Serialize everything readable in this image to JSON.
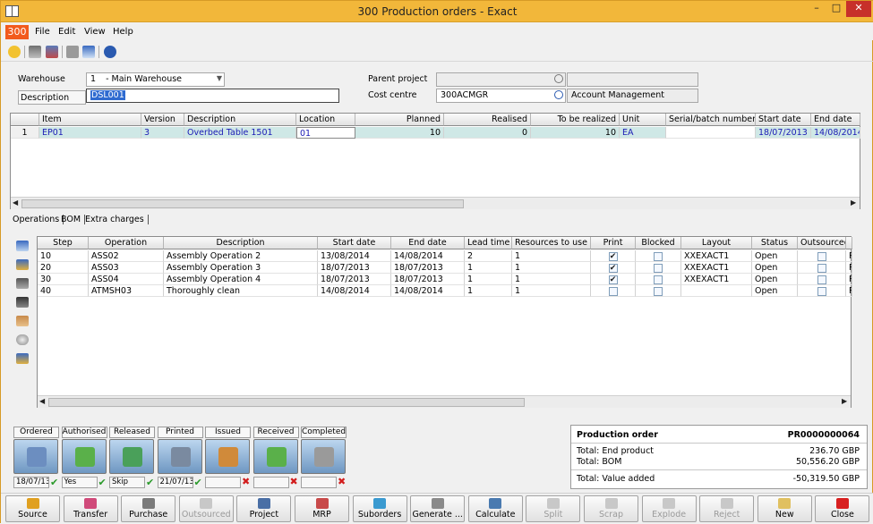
{
  "window": {
    "title": "300 Production orders - Exact",
    "min": "–",
    "max": "□",
    "close": "✕"
  },
  "menu": {
    "company": "300",
    "items": [
      "File",
      "Edit",
      "View",
      "Help"
    ]
  },
  "header": {
    "warehouse_label": "Warehouse",
    "warehouse_code": "1",
    "warehouse_name": "- Main Warehouse",
    "description_label": "Description",
    "description_value": "DSL001",
    "parent_project_label": "Parent project",
    "parent_project_value": "",
    "parent_project_desc": "",
    "cost_centre_label": "Cost centre",
    "cost_centre_value": "300ACMGR",
    "cost_centre_desc": "Account Management"
  },
  "items_grid": {
    "headers": [
      "Item",
      "Version",
      "Description",
      "Location",
      "Planned",
      "Realised",
      "To be realized",
      "Unit",
      "Serial/batch numbers",
      "Start date",
      "End date"
    ],
    "rows": [
      [
        "1",
        "EP01",
        "3",
        "Overbed Table 1501",
        "01",
        "10",
        "0",
        "10",
        "EA",
        "",
        "18/07/2013",
        "14/08/2014"
      ]
    ]
  },
  "tabs": [
    "Operations",
    "BOM",
    "Extra charges"
  ],
  "ops_grid": {
    "headers": [
      "Step",
      "Operation",
      "Description",
      "Start date",
      "End date",
      "Lead time",
      "Resources to use",
      "Print",
      "Blocked",
      "Layout",
      "Status",
      "Outsourced"
    ],
    "rows": [
      {
        "step": "10",
        "op": "ASS02",
        "desc": "Assembly Operation 2",
        "start": "13/08/2014",
        "end": "14/08/2014",
        "lead": "2",
        "res": "1",
        "print": true,
        "blocked": false,
        "layout": "XXEXACT1",
        "status": "Open",
        "outs": false,
        "extra": "P"
      },
      {
        "step": "20",
        "op": "ASS03",
        "desc": "Assembly Operation 3",
        "start": "18/07/2013",
        "end": "18/07/2013",
        "lead": "1",
        "res": "1",
        "print": true,
        "blocked": false,
        "layout": "XXEXACT1",
        "status": "Open",
        "outs": false,
        "extra": "P"
      },
      {
        "step": "30",
        "op": "ASS04",
        "desc": "Assembly Operation 4",
        "start": "18/07/2013",
        "end": "18/07/2013",
        "lead": "1",
        "res": "1",
        "print": true,
        "blocked": false,
        "layout": "XXEXACT1",
        "status": "Open",
        "outs": false,
        "extra": "P"
      },
      {
        "step": "40",
        "op": "ATMSH03",
        "desc": "Thoroughly clean",
        "start": "14/08/2014",
        "end": "14/08/2014",
        "lead": "1",
        "res": "1",
        "print": false,
        "blocked": false,
        "layout": "",
        "status": "Open",
        "outs": false,
        "extra": "P"
      }
    ]
  },
  "status_steps": [
    {
      "label": "Ordered",
      "value": "18/07/13",
      "mark": "ok"
    },
    {
      "label": "Authorised",
      "value": "Yes",
      "mark": "ok"
    },
    {
      "label": "Released",
      "value": "Skip",
      "mark": "ok"
    },
    {
      "label": "Printed",
      "value": "21/07/13",
      "mark": "ok"
    },
    {
      "label": "Issued",
      "value": "",
      "mark": "x"
    },
    {
      "label": "Received",
      "value": "",
      "mark": "x"
    },
    {
      "label": "Completed",
      "value": "",
      "mark": "x"
    }
  ],
  "summary": {
    "title": "Production order",
    "order_no": "PR0000000064",
    "end_product_label": "Total: End product",
    "end_product_value": "236.70 GBP",
    "bom_label": "Total: BOM",
    "bom_value": "50,556.20 GBP",
    "value_added_label": "Total: Value added",
    "value_added_value": "-50,319.50 GBP"
  },
  "actions": [
    {
      "label": "Source",
      "enabled": true,
      "icon": "source-icon",
      "color": "#e0a020"
    },
    {
      "label": "Transfer",
      "enabled": true,
      "icon": "transfer-icon",
      "color": "#d04a7a"
    },
    {
      "label": "Purchase",
      "enabled": true,
      "icon": "purchase-icon",
      "color": "#7a7a7a"
    },
    {
      "label": "Outsourced",
      "enabled": false,
      "icon": "outsourced-icon",
      "color": "#888"
    },
    {
      "label": "Project",
      "enabled": true,
      "icon": "project-icon",
      "color": "#4a6fa5"
    },
    {
      "label": "MRP",
      "enabled": true,
      "icon": "mrp-icon",
      "color": "#c84a4a"
    },
    {
      "label": "Suborders",
      "enabled": true,
      "icon": "suborders-icon",
      "color": "#3a9ad0"
    },
    {
      "label": "Generate ...",
      "enabled": true,
      "icon": "generate-icon",
      "color": "#8a8a8a"
    },
    {
      "label": "Calculate",
      "enabled": true,
      "icon": "calculate-icon",
      "color": "#4a7ab0"
    },
    {
      "label": "Split",
      "enabled": false,
      "icon": "split-icon",
      "color": "#888"
    },
    {
      "label": "Scrap",
      "enabled": false,
      "icon": "scrap-icon",
      "color": "#888"
    },
    {
      "label": "Explode",
      "enabled": false,
      "icon": "explode-icon",
      "color": "#888"
    },
    {
      "label": "Reject",
      "enabled": false,
      "icon": "reject-icon",
      "color": "#888"
    },
    {
      "label": "New",
      "enabled": true,
      "icon": "new-icon",
      "color": "#e0c060"
    },
    {
      "label": "Close",
      "enabled": true,
      "icon": "close-icon",
      "color": "#d82020"
    }
  ]
}
